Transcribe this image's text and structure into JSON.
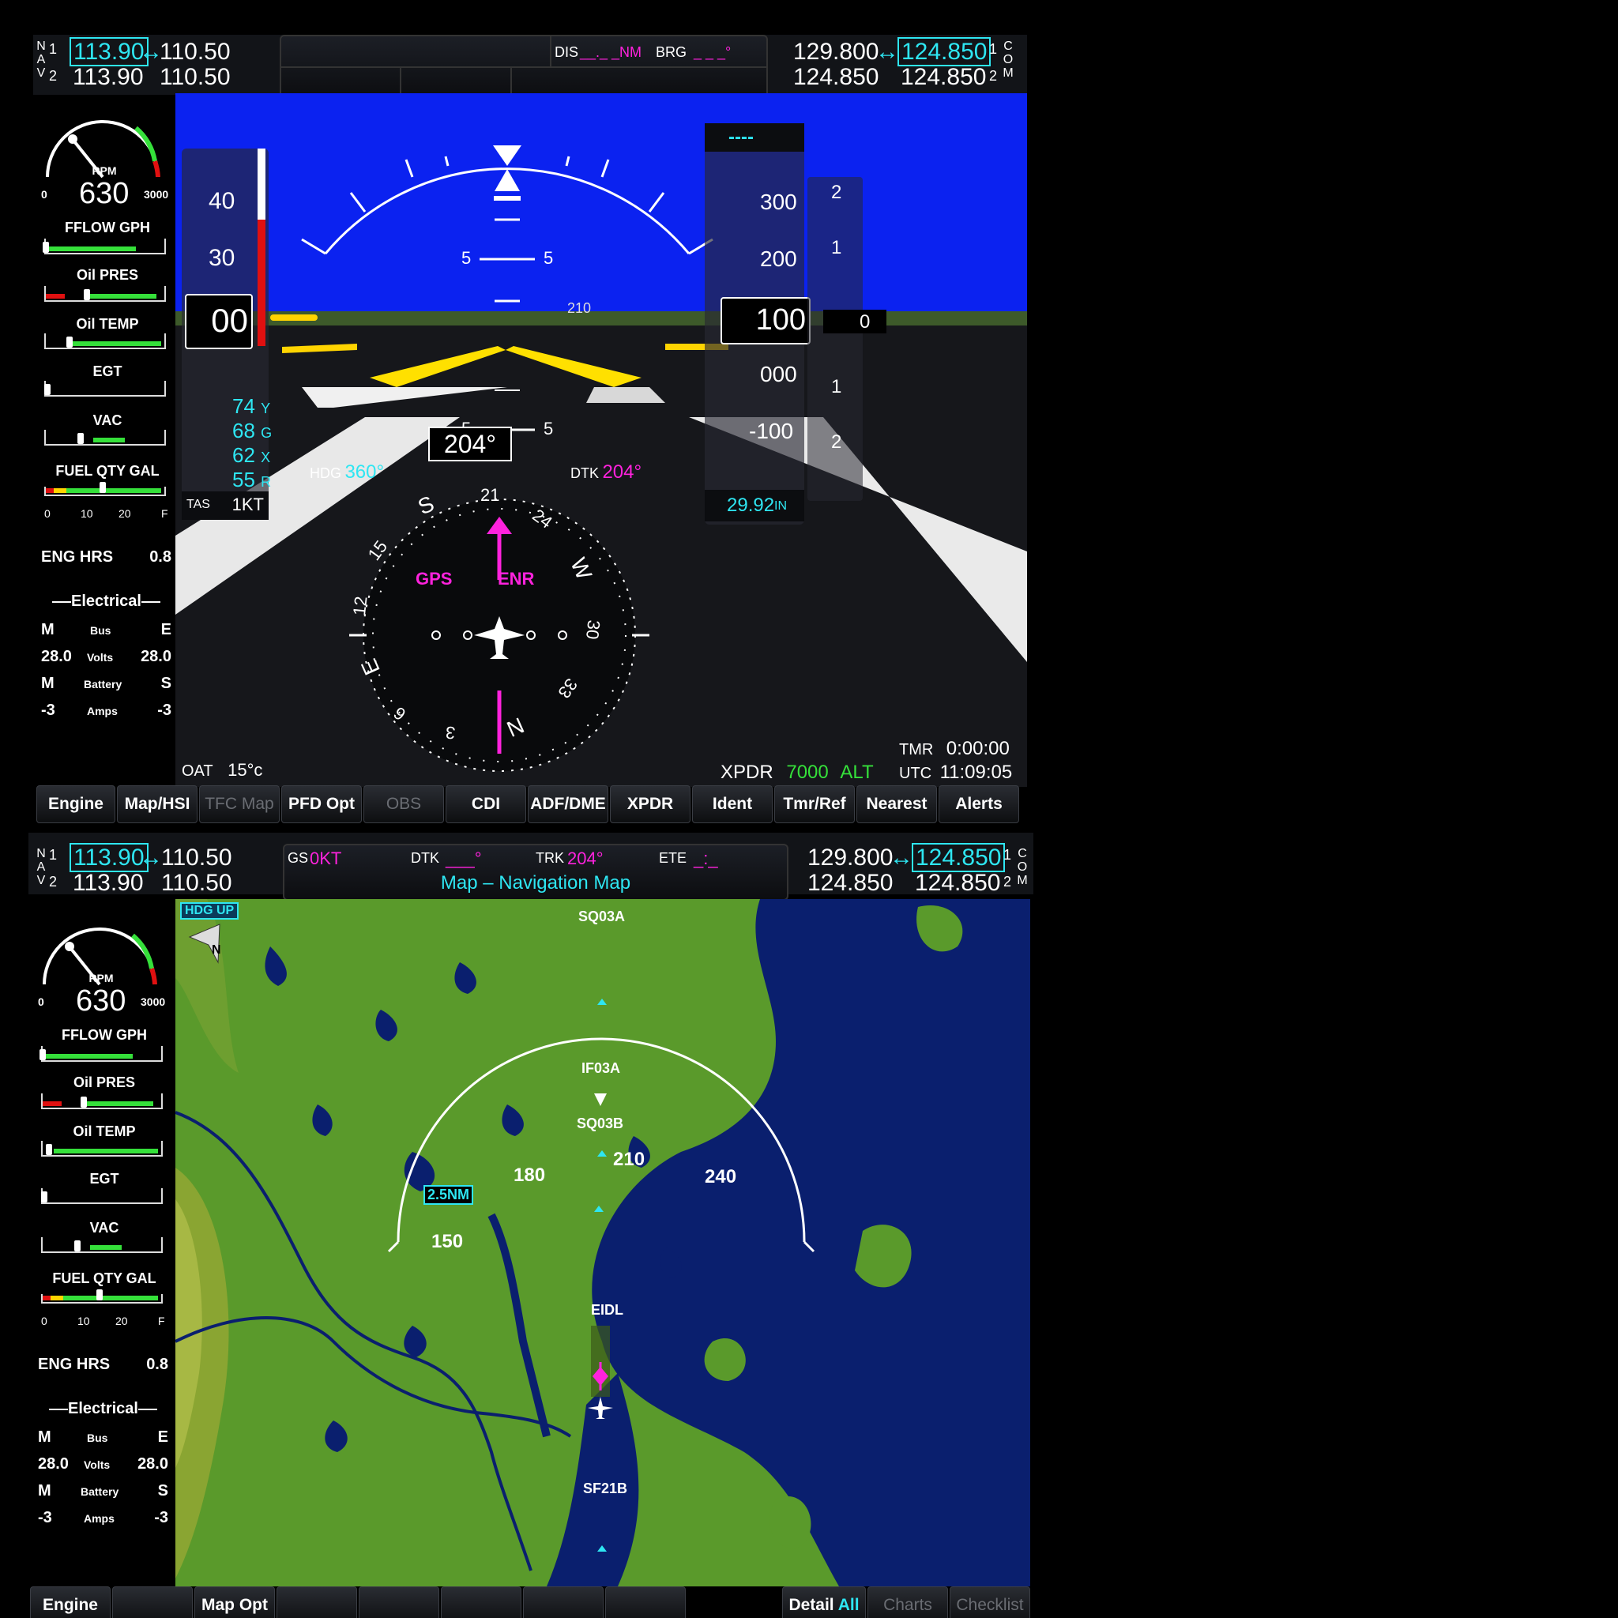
{
  "pfd": {
    "nav": {
      "label_letters": [
        "N",
        "A",
        "V"
      ],
      "nav1_index": "1",
      "nav2_index": "2",
      "nav1_active": "113.90",
      "nav1_standby": "110.50",
      "nav2_active": "113.90",
      "nav2_standby": "110.50",
      "swap_symbol": "↔"
    },
    "com": {
      "label_letters": [
        "C",
        "O",
        "M"
      ],
      "com1_index": "1",
      "com2_index": "2",
      "com1_standby": "129.800",
      "com1_active": "124.850",
      "com2_standby": "124.850",
      "com2_active": "124.850"
    },
    "center_bar": {
      "dis_label": "DIS",
      "dis_value": "__._ _NM",
      "brg_label": "BRG",
      "brg_value": "_ _ _°"
    },
    "engine": {
      "rpm_label": "RPM",
      "rpm_value": "630",
      "rpm_min": "0",
      "rpm_max": "3000",
      "fflow_label": "FFLOW GPH",
      "oil_pres_label": "Oil PRES",
      "oil_temp_label": "Oil TEMP",
      "egt_label": "EGT",
      "vac_label": "VAC",
      "fuel_label": "FUEL QTY GAL",
      "fuel_ticks": [
        "0",
        "10",
        "20",
        "F"
      ],
      "eng_hrs_label": "ENG HRS",
      "eng_hrs_value": "0.8",
      "electrical_label": "Electrical",
      "bus_row": [
        "M",
        "Bus",
        "E"
      ],
      "volts_row": [
        "28.0",
        "Volts",
        "28.0"
      ],
      "battery_row": [
        "M",
        "Battery",
        "S"
      ],
      "amps_row": [
        "-3",
        "Amps",
        "-3"
      ]
    },
    "airspeed": {
      "ticks": [
        "40",
        "30"
      ],
      "current": "00",
      "vspeeds": [
        {
          "v": "74",
          "l": "Y"
        },
        {
          "v": "68",
          "l": "G"
        },
        {
          "v": "62",
          "l": "X"
        },
        {
          "v": "55",
          "l": "R"
        }
      ],
      "tas_label": "TAS",
      "tas_value": "1KT"
    },
    "altitude": {
      "selected": "----",
      "ticks": [
        "300",
        "200",
        "000",
        "-100"
      ],
      "current": "100",
      "vsi_marks": [
        "2",
        "1",
        "1",
        "2"
      ],
      "vsi_value": "0",
      "baro": "29.92",
      "baro_unit": "IN"
    },
    "attitude": {
      "pitch_marks": [
        "5",
        "5",
        "5",
        "5"
      ],
      "heading_scale_mark": "210"
    },
    "hsi": {
      "heading_box": "204°",
      "hdg_label": "HDG",
      "hdg_value": "360°",
      "dtk_label": "DTK",
      "dtk_value": "204°",
      "gps_label": "GPS",
      "enr_label": "ENR",
      "card_labels": [
        "S",
        "21",
        "24",
        "W",
        "30",
        "33",
        "N",
        "3",
        "6",
        "E",
        "12",
        "15"
      ]
    },
    "status": {
      "oat_label": "OAT",
      "oat_value": "15°c",
      "xpdr_label": "XPDR",
      "xpdr_code": "7000",
      "xpdr_mode": "ALT",
      "tmr_label": "TMR",
      "tmr_value": "0:00:00",
      "utc_label": "UTC",
      "utc_value": "11:09:05"
    },
    "softkeys": [
      "Engine",
      "Map/HSI",
      "TFC Map",
      "PFD Opt",
      "OBS",
      "CDI",
      "ADF/DME",
      "XPDR",
      "Ident",
      "Tmr/Ref",
      "Nearest",
      "Alerts"
    ]
  },
  "mfd": {
    "center_bar": {
      "gs_label": "GS",
      "gs_value": "0KT",
      "dtk_label": "DTK",
      "dtk_value": "___°",
      "trk_label": "TRK",
      "trk_value": "204°",
      "ete_label": "ETE",
      "ete_value": "_:_",
      "page_title": "Map – Navigation Map"
    },
    "map": {
      "orientation": "HDG UP",
      "north_label": "N",
      "range": "2.5NM",
      "arc_labels": [
        "150",
        "180",
        "210",
        "240"
      ],
      "waypoints": [
        "SQ03A",
        "IF03A",
        "SQ03B",
        "EIDL",
        "SF21B"
      ]
    },
    "softkeys": [
      "Engine",
      "",
      "Map Opt",
      "",
      "",
      "",
      "",
      "",
      "",
      "Detail",
      "All",
      "Charts",
      "Checklist"
    ]
  },
  "colors": {
    "cyan": "#2ee6f2",
    "magenta": "#ff22dd",
    "sky": "#0b22f0",
    "land": "#5a9a2b",
    "water": "#0a1f6e"
  }
}
